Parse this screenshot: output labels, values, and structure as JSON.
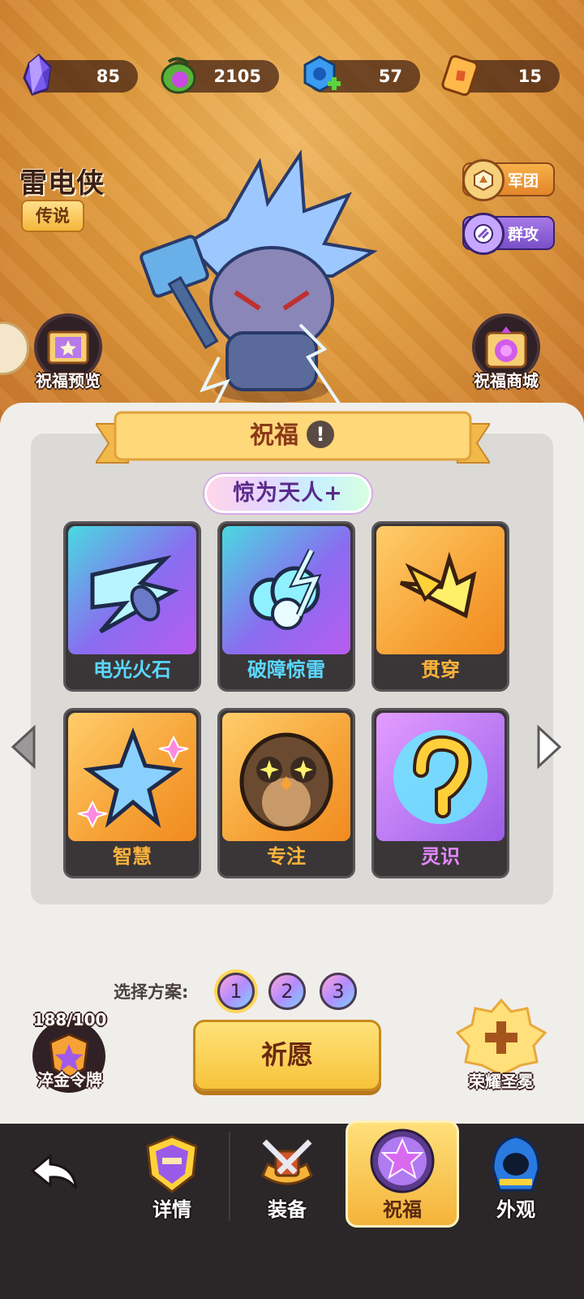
{
  "resources": [
    {
      "icon": "crystal-icon",
      "value": "85"
    },
    {
      "icon": "potion-icon",
      "value": "2105"
    },
    {
      "icon": "blue-gem-plus-icon",
      "value": "57"
    },
    {
      "icon": "ticket-icon",
      "value": "15"
    }
  ],
  "hero": {
    "name": "雷电侠",
    "rarity": "传说"
  },
  "tags": {
    "legion": "军团",
    "aoe": "群攻"
  },
  "shortcuts": {
    "preview": "祝福预览",
    "shop": "祝福商城"
  },
  "panel": {
    "title": "祝福",
    "rank": "惊为天人+",
    "blessings": [
      {
        "name": "电光火石",
        "icon": "lightning-dart-icon"
      },
      {
        "name": "破障惊雷",
        "icon": "thunder-cloud-icon"
      },
      {
        "name": "贯穿",
        "icon": "piercing-arrow-icon"
      },
      {
        "name": "智慧",
        "icon": "crystal-star-icon"
      },
      {
        "name": "专注",
        "icon": "owl-icon"
      },
      {
        "name": "灵识",
        "icon": "spiral-rune-icon"
      }
    ]
  },
  "plans": {
    "label": "选择方案:",
    "options": [
      "1",
      "2",
      "3"
    ],
    "selected": "1"
  },
  "pray": "祈愿",
  "token": {
    "count": "188/100",
    "label": "淬金令牌"
  },
  "glory": {
    "label": "荣耀圣冕"
  },
  "nav": {
    "back_icon": "back-arrow-icon",
    "items": [
      "详情",
      "装备",
      "祝福",
      "外观"
    ],
    "active": "祝福"
  }
}
